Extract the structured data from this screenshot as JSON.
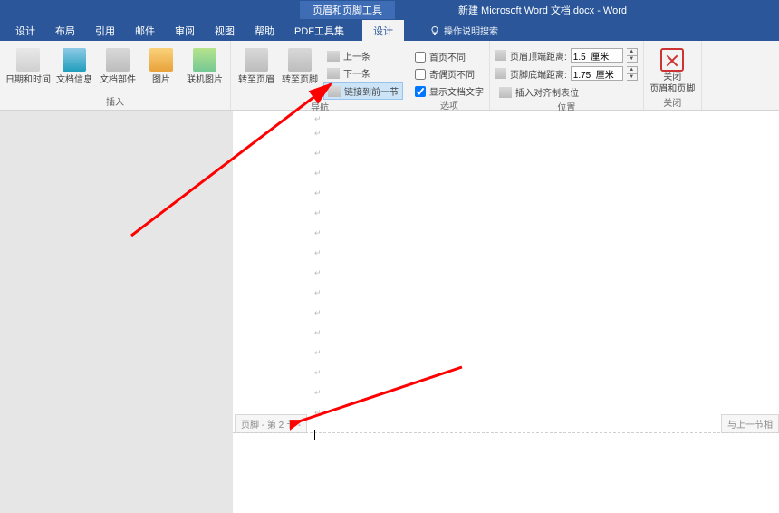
{
  "titlebar": {
    "context_tab": "页眉和页脚工具",
    "doc_title": "新建 Microsoft Word 文档.docx  -  Word"
  },
  "ribbon_tabs": {
    "items": [
      "设计",
      "布局",
      "引用",
      "邮件",
      "审阅",
      "视图",
      "帮助",
      "PDF工具集",
      "设计"
    ],
    "active_index": 8,
    "tell_me": "操作说明搜索"
  },
  "ribbon": {
    "group_insert": {
      "label": "插入",
      "btn_datetime": "日期和时间",
      "btn_docinfo": "文档信息",
      "btn_docparts": "文档部件",
      "btn_picture": "图片",
      "btn_online_picture": "联机图片"
    },
    "group_nav": {
      "label": "导航",
      "btn_goto_header": "转至页眉",
      "btn_goto_footer": "转至页脚",
      "item_prev": "上一条",
      "item_next": "下一条",
      "item_link_prev": "链接到前一节"
    },
    "group_options": {
      "label": "选项",
      "chk_first_page": "首页不同",
      "chk_odd_even": "奇偶页不同",
      "chk_show_text": "显示文档文字"
    },
    "group_position": {
      "label": "位置",
      "row_header_top": "页眉顶端距离:",
      "row_header_top_val": "1.5  厘米",
      "row_footer_bottom": "页脚底端距离:",
      "row_footer_bottom_val": "1.75  厘米",
      "item_tab_align": "插入对齐制表位"
    },
    "group_close": {
      "label": "关闭",
      "btn_close": "关闭\n页眉和页脚"
    }
  },
  "document": {
    "footer_tag_left": "页脚 - 第 2 节 -",
    "footer_tag_right": "与上一节相"
  }
}
